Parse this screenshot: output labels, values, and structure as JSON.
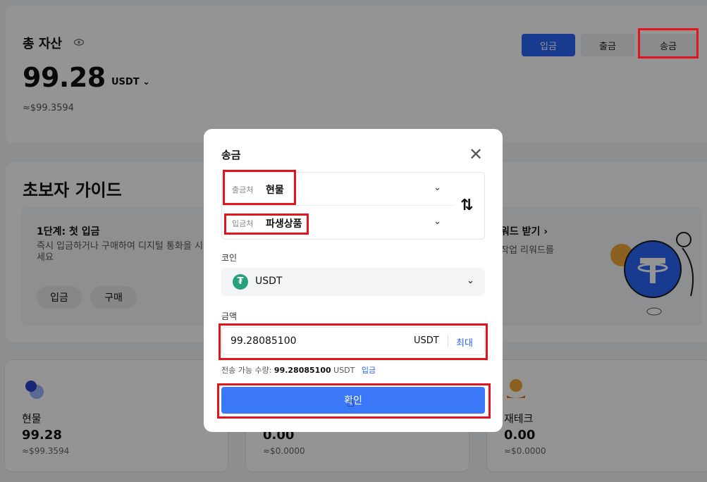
{
  "total": {
    "label": "총 자산",
    "value": "99.28",
    "unit": "USDT",
    "approx": "≈$99.3594"
  },
  "top_buttons": {
    "deposit": "입금",
    "withdraw": "출금",
    "transfer": "송금"
  },
  "guide": {
    "title": "초보자 가이드",
    "step1_title": "1단계: 첫 입금",
    "step1_desc": "즉시 입금하거나 구매하여 디지털 통화을 시작하세요",
    "pill_deposit": "입금",
    "pill_buy": "구매",
    "reward_title": "워드 받기 ›",
    "reward_desc": "작업 리워드를"
  },
  "accounts": [
    {
      "name": "현물",
      "value": "99.28",
      "approx": "≈$99.3594"
    },
    {
      "name": "",
      "value": "0.00",
      "approx": "≈$0.0000"
    },
    {
      "name": "재테크",
      "value": "0.00",
      "approx": "≈$0.0000"
    }
  ],
  "modal": {
    "title": "송금",
    "close": "✕",
    "from_label": "출금처",
    "from_value": "현물",
    "to_label": "입금처",
    "to_value": "파생상품",
    "swap_icon": "⇅",
    "coin_label": "코인",
    "coin_name": "USDT",
    "amount_label": "금액",
    "amount_value": "99.28085100",
    "amount_unit": "USDT",
    "max_label": "최대",
    "avail_prefix": "전송 가능 수량:",
    "avail_value": "99.28085100",
    "avail_unit": "USDT",
    "avail_link": "입금",
    "confirm": "확인"
  },
  "colors": {
    "accent": "#2a64f6",
    "confirm": "#3b78f7",
    "highlight": "#e3141c",
    "tether": "#26a17b"
  }
}
